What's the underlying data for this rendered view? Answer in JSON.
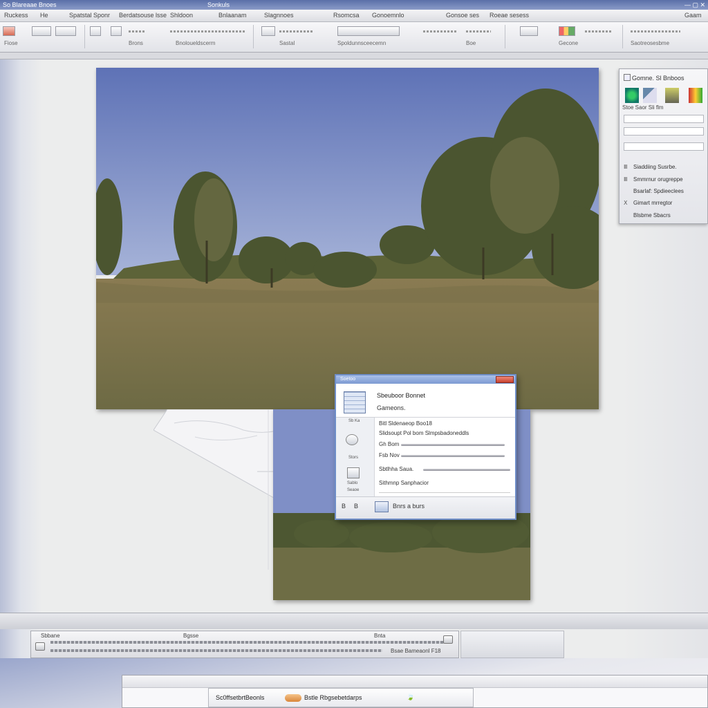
{
  "window": {
    "title": "So Blareaae Bnoes",
    "title_secondary": "Sonkuls",
    "controls": "— ▢ ✕"
  },
  "menubar": {
    "items": [
      "Ruckess",
      "He",
      "Spatstal Sponr",
      "Berdatsouse lsse",
      "Shldoon",
      "Bnlaanam",
      "Slagnnoes",
      "Rsomcsa",
      "Gonoemnlo",
      "Gonsoe ses",
      "Roeae sesess",
      "Gaam"
    ]
  },
  "ribbon": {
    "groups": [
      "Fiose",
      "Brons",
      "Bnoloueldscerm",
      "Sastal",
      "Spoldunnsceecemn",
      "Boe",
      "Gecone",
      "Saotreosesbme"
    ]
  },
  "side_panel": {
    "title": "Gomne. Sl Bnboos",
    "tools_label": "Stoe Saor Sli flm",
    "items": [
      {
        "bullet": "Ⅲ",
        "label": "Siaddiing Susrbe."
      },
      {
        "bullet": "Ⅲ",
        "label": "Smmrnur orugreppe"
      },
      {
        "bullet": "",
        "label": "Bsarlaf: Spdieeclees"
      },
      {
        "bullet": "Ⅹ",
        "label": "Gimart mrregtor"
      },
      {
        "bullet": "",
        "label": "Blsbme Sbacrs"
      }
    ]
  },
  "dialog": {
    "title": "Soetoo",
    "heading": "Sbeuboor Bonnet",
    "subheading": "Gameons.",
    "left_labels": [
      "Sb Ka",
      "Stors",
      "Sablo",
      "Seaoe"
    ],
    "lines": [
      "Bitl Sldenaeop Boo18",
      "Slidsoupt Pol bom Slmpsbadoneddls",
      "Gh Bom",
      "Fsb Nov",
      "Sbtlhha Saua.",
      "Sithmnp Sanphacior"
    ],
    "footer_buttons": [
      "B",
      "B"
    ],
    "footer_action": "Bnrs a burs"
  },
  "status": {
    "timeline_left": "Sbbane",
    "timeline_mid": "Bgsse",
    "timeline_right": "Bnta",
    "timeline_end": "Bsae Bameaonl F18"
  },
  "taskbar": {
    "tab_label": "Sc0ffsetbrtBeonls",
    "tab_label2": "Bstle Rbgsebetdarps",
    "tab_icon": "🍃"
  },
  "colors": {
    "titlebar": "#5a6fa8",
    "dialog_border": "#6f8ec8",
    "sky": "#6b7fbf",
    "grass": "#7c744e",
    "tree": "#4f5a2e"
  }
}
